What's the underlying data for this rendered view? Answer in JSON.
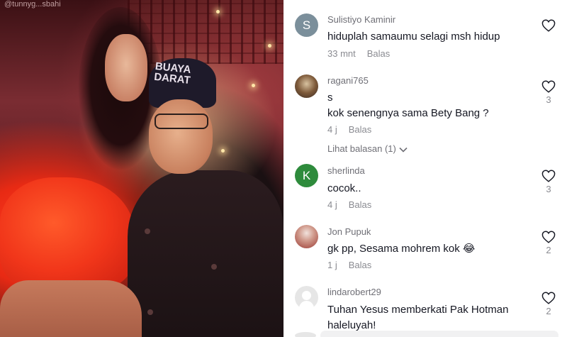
{
  "video": {
    "handle": "@tunnyg...sbahi",
    "cap_text": "BUAYA DARAT"
  },
  "comments": [
    {
      "username": "Sulistiyo Kaminir",
      "avatar_letter": "S",
      "avatar_color": "#7b8f9b",
      "text": "hiduplah samaumu selagi msh hidup",
      "time": "33 mnt",
      "reply": "Balas",
      "likes": ""
    },
    {
      "username": "ragani765",
      "avatar_letter": "",
      "text_line1": "s",
      "text": "kok senengnya sama Bety Bang ?",
      "time": "4 j",
      "reply": "Balas",
      "likes": "3",
      "view_replies": "Lihat balasan (1)"
    },
    {
      "username": "sherlinda",
      "avatar_letter": "K",
      "avatar_color": "#2e8b3c",
      "text": "cocok..",
      "time": "4 j",
      "reply": "Balas",
      "likes": "3"
    },
    {
      "username": "Jon Pupuk",
      "avatar_letter": "",
      "text": "gk pp, Sesama mohrem kok 😂",
      "time": "1 j",
      "reply": "Balas",
      "likes": "2"
    },
    {
      "username": "lindarobert29",
      "avatar_letter": "",
      "text": "Tuhan Yesus memberkati Pak Hotman",
      "text_line2": "haleluyah!",
      "likes": "2"
    }
  ],
  "icons": {
    "heart": "heart-outline-icon",
    "chevron": "chevron-down-icon"
  }
}
